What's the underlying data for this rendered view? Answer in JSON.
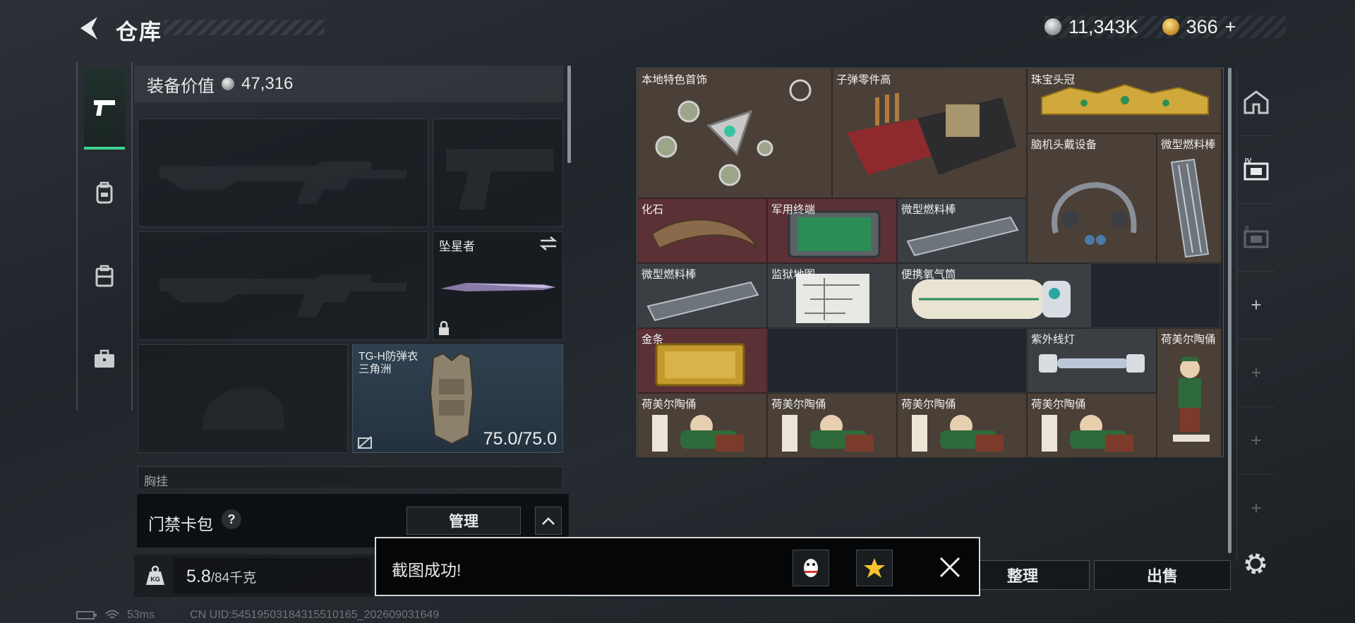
{
  "header": {
    "title": "仓库"
  },
  "currency": [
    {
      "name": "hafu-coin",
      "value": "11,343K",
      "color": "#b7b9bc"
    },
    {
      "name": "triangle-coin",
      "value": "366",
      "plus": "+",
      "color": "#d8a23a"
    }
  ],
  "equipment": {
    "value_label": "装备价值",
    "value": "47,316",
    "melee_name": "坠星者",
    "armor_name": "TG-H防弹衣",
    "armor_subtitle": "三角洲",
    "armor_durability": "75.0/75.0",
    "chest_label": "胸挂"
  },
  "card_pack": {
    "label": "门禁卡包",
    "help": "?",
    "manage_label": "管理"
  },
  "weight": {
    "current": "5.8",
    "max": "/84千克"
  },
  "inventory": {
    "items": [
      {
        "name": "本地特色首饰"
      },
      {
        "name": "子弹零件高"
      },
      {
        "name": "珠宝头冠"
      },
      {
        "name": "脑机头戴设备"
      },
      {
        "name": "微型燃料棒"
      },
      {
        "name": "化石"
      },
      {
        "name": "军用终端"
      },
      {
        "name": "微型燃料棒"
      },
      {
        "name": "微型燃料棒"
      },
      {
        "name": "监狱地图"
      },
      {
        "name": "便携氧气筒"
      },
      {
        "name": "金条"
      },
      {
        "name": "紫外线灯"
      },
      {
        "name": "荷美尔陶俑"
      },
      {
        "name": "荷美尔陶俑"
      },
      {
        "name": "荷美尔陶俑"
      },
      {
        "name": "荷美尔陶俑"
      },
      {
        "name": "荷美尔陶俑"
      }
    ]
  },
  "actions": {
    "sort_label": "整理",
    "sell_label": "出售"
  },
  "toast": {
    "message": "截图成功!"
  },
  "status": {
    "ping": "53ms",
    "uid": "CN UID:5451950318431551016​5_202609031649"
  }
}
